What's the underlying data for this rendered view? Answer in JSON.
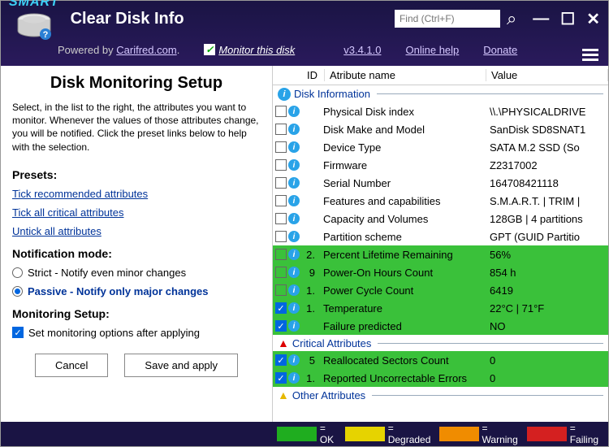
{
  "header": {
    "smart": "SMART",
    "title": "Clear Disk Info",
    "powered_prefix": "Powered by ",
    "powered_link": "Carifred.com",
    "monitor_label": "Monitor this disk",
    "version": "v3.4.1.0",
    "help": "Online help",
    "donate": "Donate",
    "search_placeholder": "Find (Ctrl+F)"
  },
  "left": {
    "heading": "Disk Monitoring Setup",
    "desc": "Select, in the list to the right, the attributes you want to monitor. Whenever the values of those attributes change, you will be notified. Click the preset links below to help with the selection.",
    "presets_h": "Presets:",
    "preset1": "Tick recommended attributes",
    "preset2": "Tick all critical attributes",
    "preset3": "Untick all attributes",
    "notif_h": "Notification mode:",
    "strict": "Strict - Notify even minor changes",
    "passive": "Passive - Notify only major changes",
    "setup_h": "Monitoring Setup:",
    "setopts": "Set monitoring options after applying",
    "cancel": "Cancel",
    "save": "Save and apply"
  },
  "cols": {
    "id": "ID",
    "name": "Atribute name",
    "value": "Value"
  },
  "sections": {
    "disk_info": "Disk Information",
    "critical": "Critical Attributes",
    "other": "Other Attributes"
  },
  "rows": [
    {
      "chk": false,
      "id": "",
      "name": "Physical Disk index",
      "value": "\\\\.\\PHYSICALDRIVE",
      "hl": false
    },
    {
      "chk": false,
      "id": "",
      "name": "Disk Make and Model",
      "value": "SanDisk SD8SNAT1",
      "hl": false
    },
    {
      "chk": false,
      "id": "",
      "name": "Device Type",
      "value": "SATA  M.2 SSD (So",
      "hl": false
    },
    {
      "chk": false,
      "id": "",
      "name": "Firmware",
      "value": "Z2317002",
      "hl": false
    },
    {
      "chk": false,
      "id": "",
      "name": "Serial Number",
      "value": "164708421118",
      "hl": false
    },
    {
      "chk": false,
      "id": "",
      "name": "Features and capabilities",
      "value": "S.M.A.R.T. | TRIM |",
      "hl": false
    },
    {
      "chk": false,
      "id": "",
      "name": "Capacity and Volumes",
      "value": "128GB | 4 partitions",
      "hl": false
    },
    {
      "chk": false,
      "id": "",
      "name": "Partition scheme",
      "value": "GPT (GUID Partitio",
      "hl": false
    },
    {
      "chk": false,
      "id": "2.",
      "name": "Percent Lifetime Remaining",
      "value": "56%",
      "hl": true
    },
    {
      "chk": false,
      "id": "9",
      "name": "Power-On Hours Count",
      "value": "854 h",
      "hl": true
    },
    {
      "chk": false,
      "id": "1.",
      "name": "Power Cycle Count",
      "value": "6419",
      "hl": true
    },
    {
      "chk": true,
      "id": "1.",
      "name": "Temperature",
      "value": "22°C | 71°F",
      "hl": true
    },
    {
      "chk": true,
      "id": "",
      "name": "Failure predicted",
      "value": "NO",
      "hl": true
    }
  ],
  "crit_rows": [
    {
      "chk": true,
      "id": "5",
      "name": "Reallocated Sectors Count",
      "value": "0",
      "hl": true
    },
    {
      "chk": true,
      "id": "1.",
      "name": "Reported Uncorrectable Errors",
      "value": "0",
      "hl": true
    }
  ],
  "status": {
    "ok": "= OK",
    "deg": "= Degraded",
    "warn": "= Warning",
    "fail": "= Failing"
  }
}
